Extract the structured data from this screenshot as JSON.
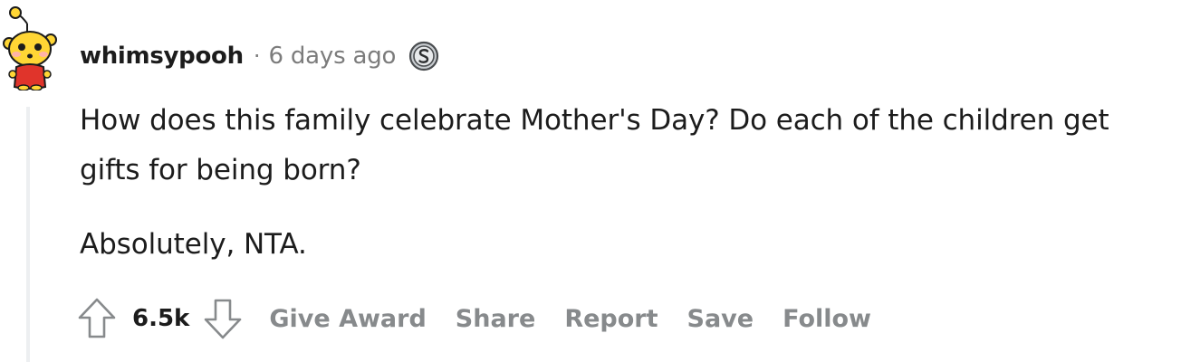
{
  "comment": {
    "author": "whimsypooh",
    "separator": "·",
    "time_ago": "6 days ago",
    "paragraphs": [
      "How does this family celebrate Mother's Day? Do each of the children get gifts for being born?",
      "Absolutely, NTA."
    ],
    "score": "6.5k"
  },
  "actions": {
    "give_award": "Give Award",
    "share": "Share",
    "report": "Report",
    "save": "Save",
    "follow": "Follow"
  },
  "icons": {
    "avatar": "snoo-avatar-icon",
    "award": "silver-award-icon",
    "upvote": "upvote-arrow-icon",
    "downvote": "downvote-arrow-icon"
  },
  "colors": {
    "text": "#1c1c1c",
    "muted": "#7c7c7c",
    "action": "#878a8c",
    "thread_line": "#edeff1",
    "avatar_face": "#ffd635",
    "avatar_shirt": "#e0342b"
  }
}
